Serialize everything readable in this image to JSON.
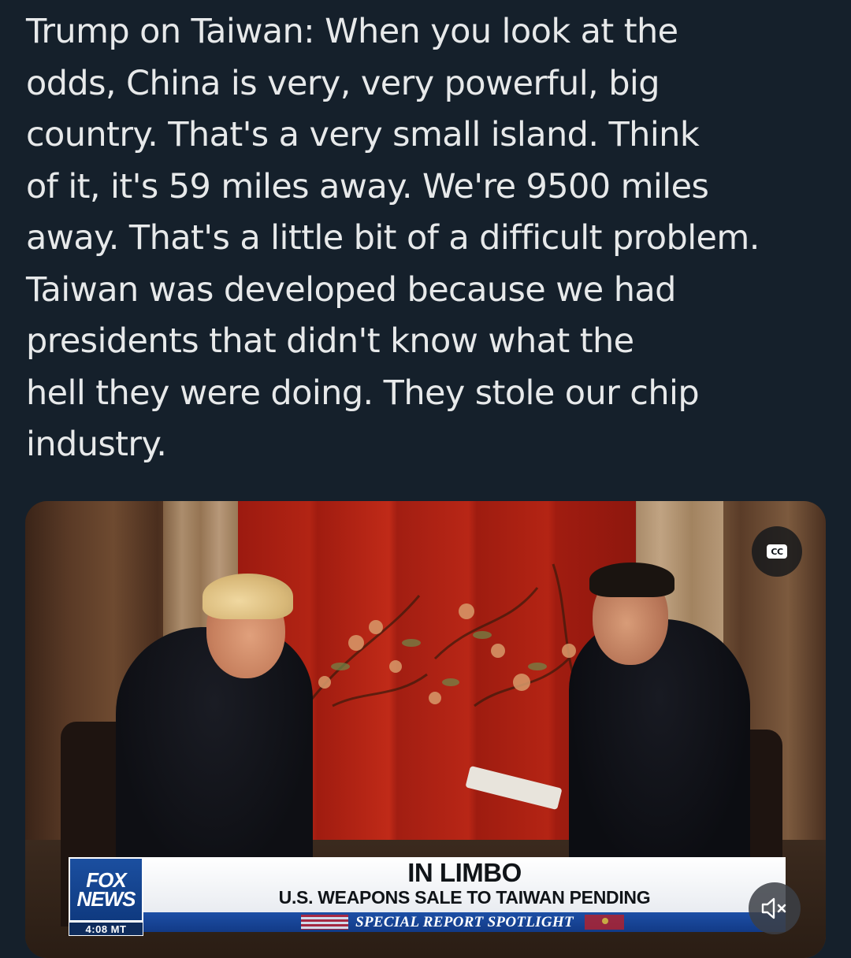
{
  "tweet": {
    "lines": [
      "Trump on Taiwan: When you look at the",
      "odds, China is very, very powerful, big",
      "country. That's a very small island. Think",
      "of it, it's 59 miles away. We're 9500 miles",
      "away. That's a little bit of a difficult problem.",
      "Taiwan was developed because we had",
      "presidents that didn't know what the",
      "hell they were doing. They stole our chip",
      "industry."
    ]
  },
  "video": {
    "cc_label": "CC",
    "mute_icon": "speaker-muted-icon",
    "lower_third": {
      "logo_top": "FOX",
      "logo_bottom": "NEWS",
      "time": "4:08 MT",
      "headline": "IN LIMBO",
      "subheadline": "U.S. WEAPONS SALE TO TAIWAN PENDING",
      "segment": "SPECIAL REPORT SPOTLIGHT"
    }
  },
  "colors": {
    "background": "#15202b",
    "text": "#e7e9ea",
    "fox_blue": "#1b4fa0"
  }
}
